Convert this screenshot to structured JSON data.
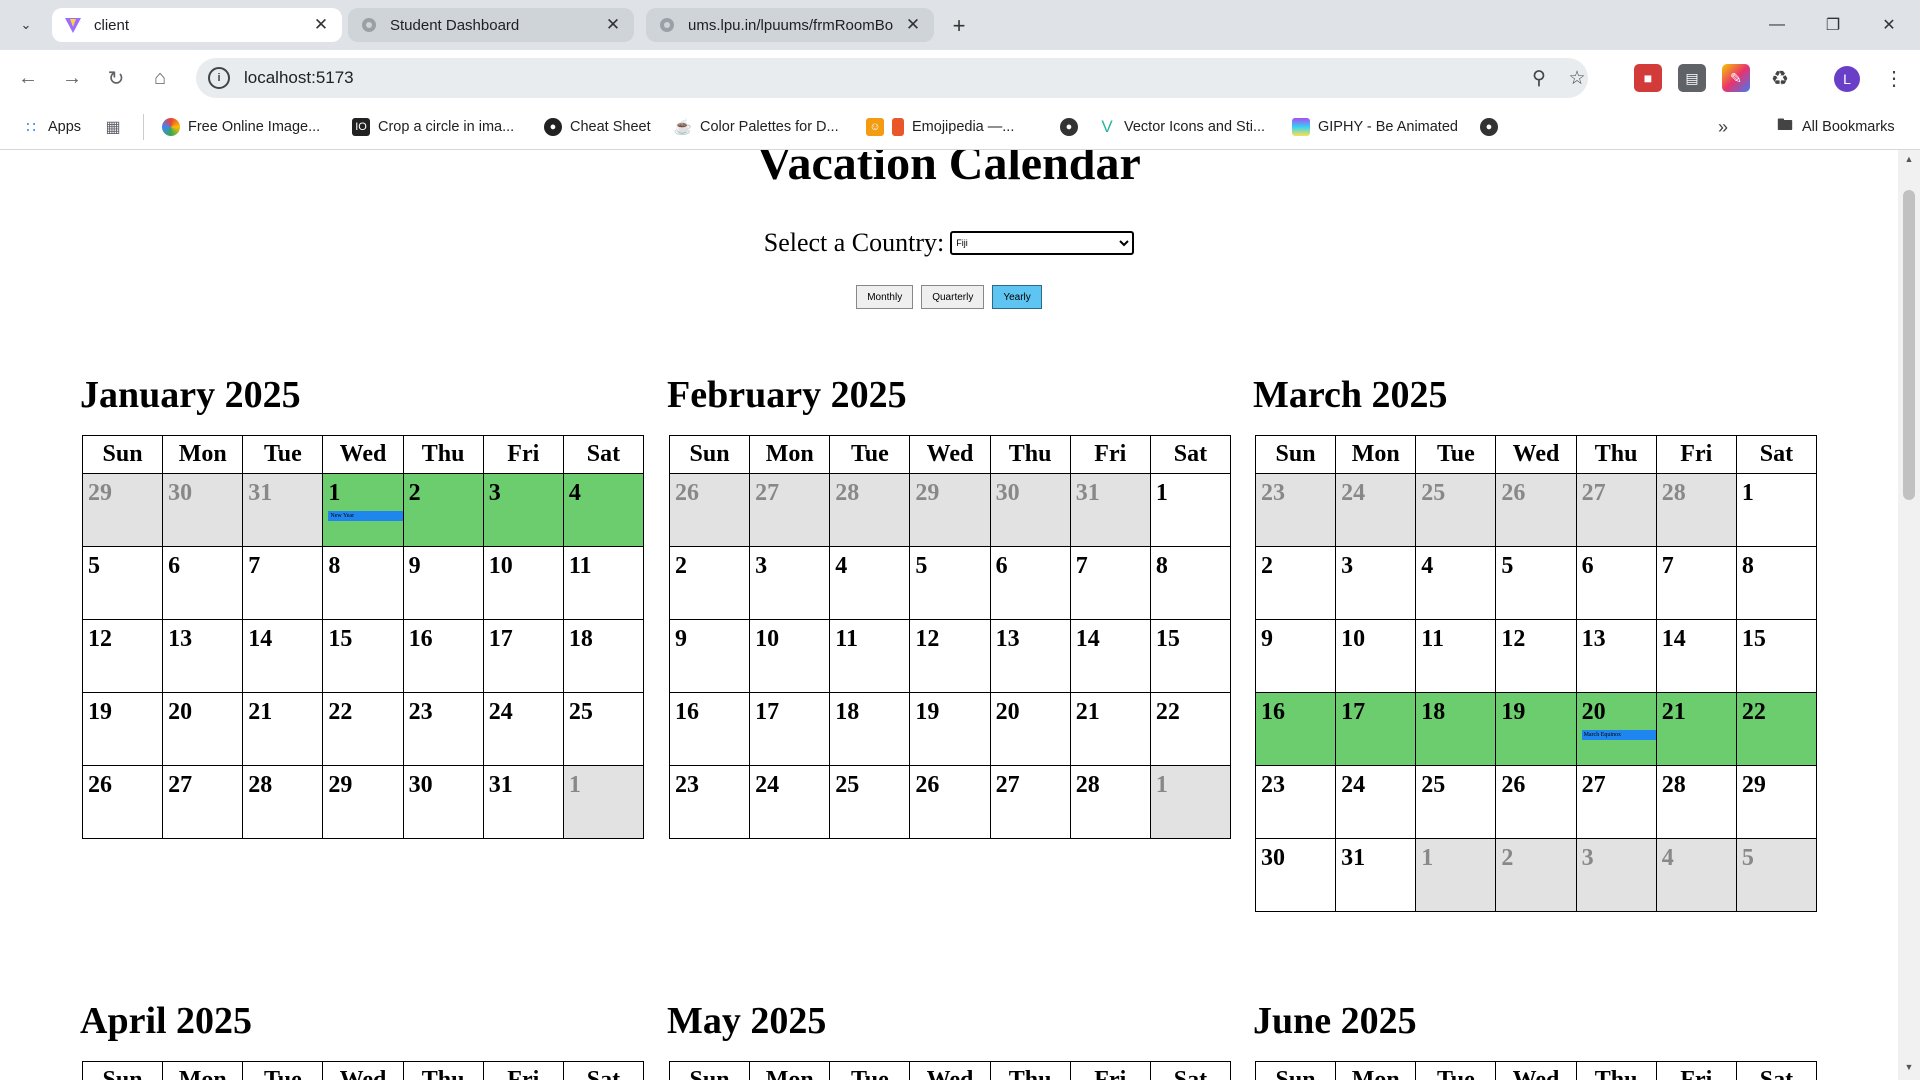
{
  "browser": {
    "tabs": [
      {
        "title": "client",
        "icon": "vite-logo-icon",
        "active": true
      },
      {
        "title": "Student Dashboard",
        "icon": "globe-icon",
        "active": false
      },
      {
        "title": "ums.lpu.in/lpuums/frmRoomBo",
        "icon": "globe-icon",
        "active": false
      }
    ],
    "url": "localhost:5173",
    "bookmarks": [
      {
        "label": "Apps"
      },
      {
        "label": "Free Online Image..."
      },
      {
        "label": "Crop a circle in ima..."
      },
      {
        "label": "Cheat Sheet"
      },
      {
        "label": "Color Palettes for D..."
      },
      {
        "label": "Emojipedia —..."
      },
      {
        "label": "Vector Icons and Sti..."
      },
      {
        "label": "GIPHY - Be Animated"
      },
      {
        "label": "All Bookmarks"
      }
    ],
    "avatar_letter": "L"
  },
  "page": {
    "title": "Vacation Calendar",
    "country_label": "Select a Country:",
    "country_selected": "Fiji",
    "views": [
      "Monthly",
      "Quarterly",
      "Yearly"
    ],
    "active_view": "Yearly"
  },
  "weekdays": [
    "Sun",
    "Mon",
    "Tue",
    "Wed",
    "Thu",
    "Fri",
    "Sat"
  ],
  "months": [
    {
      "name": "January 2025",
      "weeks": [
        [
          {
            "d": "29",
            "o": true
          },
          {
            "d": "30",
            "o": true
          },
          {
            "d": "31",
            "o": true
          },
          {
            "d": "1",
            "h": true,
            "e": "New Year"
          },
          {
            "d": "2",
            "h": true
          },
          {
            "d": "3",
            "h": true
          },
          {
            "d": "4",
            "h": true
          }
        ],
        [
          {
            "d": "5"
          },
          {
            "d": "6"
          },
          {
            "d": "7"
          },
          {
            "d": "8"
          },
          {
            "d": "9"
          },
          {
            "d": "10"
          },
          {
            "d": "11"
          }
        ],
        [
          {
            "d": "12"
          },
          {
            "d": "13"
          },
          {
            "d": "14"
          },
          {
            "d": "15"
          },
          {
            "d": "16"
          },
          {
            "d": "17"
          },
          {
            "d": "18"
          }
        ],
        [
          {
            "d": "19"
          },
          {
            "d": "20"
          },
          {
            "d": "21"
          },
          {
            "d": "22"
          },
          {
            "d": "23"
          },
          {
            "d": "24"
          },
          {
            "d": "25"
          }
        ],
        [
          {
            "d": "26"
          },
          {
            "d": "27"
          },
          {
            "d": "28"
          },
          {
            "d": "29"
          },
          {
            "d": "30"
          },
          {
            "d": "31"
          },
          {
            "d": "1",
            "o": true
          }
        ]
      ]
    },
    {
      "name": "February 2025",
      "weeks": [
        [
          {
            "d": "26",
            "o": true
          },
          {
            "d": "27",
            "o": true
          },
          {
            "d": "28",
            "o": true
          },
          {
            "d": "29",
            "o": true
          },
          {
            "d": "30",
            "o": true
          },
          {
            "d": "31",
            "o": true
          },
          {
            "d": "1"
          }
        ],
        [
          {
            "d": "2"
          },
          {
            "d": "3"
          },
          {
            "d": "4"
          },
          {
            "d": "5"
          },
          {
            "d": "6"
          },
          {
            "d": "7"
          },
          {
            "d": "8"
          }
        ],
        [
          {
            "d": "9"
          },
          {
            "d": "10"
          },
          {
            "d": "11"
          },
          {
            "d": "12"
          },
          {
            "d": "13"
          },
          {
            "d": "14"
          },
          {
            "d": "15"
          }
        ],
        [
          {
            "d": "16"
          },
          {
            "d": "17"
          },
          {
            "d": "18"
          },
          {
            "d": "19"
          },
          {
            "d": "20"
          },
          {
            "d": "21"
          },
          {
            "d": "22"
          }
        ],
        [
          {
            "d": "23"
          },
          {
            "d": "24"
          },
          {
            "d": "25"
          },
          {
            "d": "26"
          },
          {
            "d": "27"
          },
          {
            "d": "28"
          },
          {
            "d": "1",
            "o": true
          }
        ]
      ]
    },
    {
      "name": "March 2025",
      "weeks": [
        [
          {
            "d": "23",
            "o": true
          },
          {
            "d": "24",
            "o": true
          },
          {
            "d": "25",
            "o": true
          },
          {
            "d": "26",
            "o": true
          },
          {
            "d": "27",
            "o": true
          },
          {
            "d": "28",
            "o": true
          },
          {
            "d": "1"
          }
        ],
        [
          {
            "d": "2"
          },
          {
            "d": "3"
          },
          {
            "d": "4"
          },
          {
            "d": "5"
          },
          {
            "d": "6"
          },
          {
            "d": "7"
          },
          {
            "d": "8"
          }
        ],
        [
          {
            "d": "9"
          },
          {
            "d": "10"
          },
          {
            "d": "11"
          },
          {
            "d": "12"
          },
          {
            "d": "13"
          },
          {
            "d": "14"
          },
          {
            "d": "15"
          }
        ],
        [
          {
            "d": "16",
            "h": true
          },
          {
            "d": "17",
            "h": true
          },
          {
            "d": "18",
            "h": true
          },
          {
            "d": "19",
            "h": true
          },
          {
            "d": "20",
            "h": true,
            "e": "March Equinox"
          },
          {
            "d": "21",
            "h": true
          },
          {
            "d": "22",
            "h": true
          }
        ],
        [
          {
            "d": "23"
          },
          {
            "d": "24"
          },
          {
            "d": "25"
          },
          {
            "d": "26"
          },
          {
            "d": "27"
          },
          {
            "d": "28"
          },
          {
            "d": "29"
          }
        ],
        [
          {
            "d": "30"
          },
          {
            "d": "31"
          },
          {
            "d": "1",
            "o": true
          },
          {
            "d": "2",
            "o": true
          },
          {
            "d": "3",
            "o": true
          },
          {
            "d": "4",
            "o": true
          },
          {
            "d": "5",
            "o": true
          }
        ]
      ]
    },
    {
      "name": "April 2025",
      "weeks": []
    },
    {
      "name": "May 2025",
      "weeks": []
    },
    {
      "name": "June 2025",
      "weeks": []
    }
  ],
  "colors": {
    "holiday": "#6ccd6e",
    "other_month": "#e2e2e2",
    "event": "#1e86ee",
    "active_button": "#5ec4f2"
  }
}
